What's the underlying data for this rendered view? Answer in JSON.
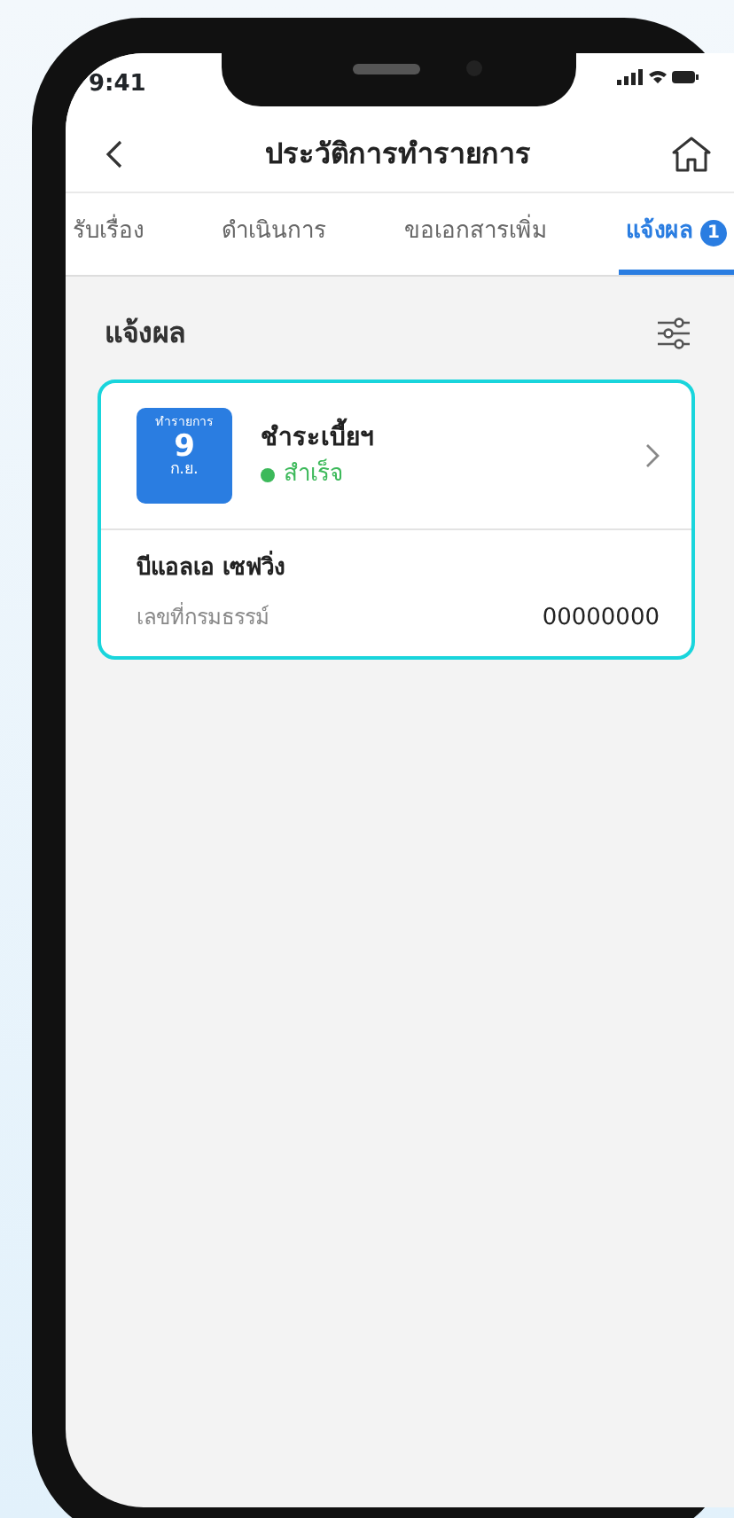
{
  "status_bar": {
    "time": "9:41"
  },
  "header": {
    "title": "ประวัติการทำรายการ"
  },
  "tabs": [
    {
      "label": "รับเรื่อง",
      "selected": false
    },
    {
      "label": "ดำเนินการ",
      "selected": false
    },
    {
      "label": "ขอเอกสารเพิ่ม",
      "selected": false
    },
    {
      "label": "แจ้งผล",
      "selected": true,
      "badge": "1"
    }
  ],
  "section": {
    "title": "แจ้งผล"
  },
  "transactions": [
    {
      "date_caption": "ทำรายการ",
      "day": "9",
      "month": "ก.ย.",
      "title": "ชำระเบี้ยฯ",
      "status": "สำเร็จ",
      "color": "#3cb95a",
      "selected": true,
      "name": "บีแอลเอ เซฟวิ่ง",
      "field_label": "เลขที่กรมธรรม์",
      "field_value": "00000000"
    }
  ]
}
